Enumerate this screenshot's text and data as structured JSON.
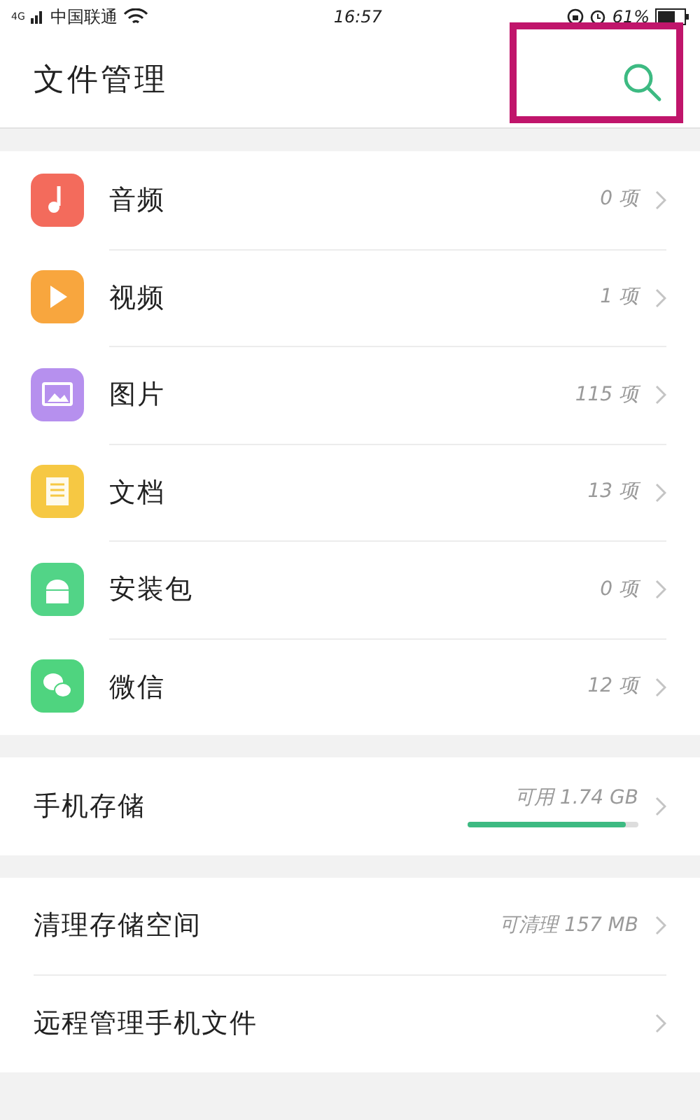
{
  "status_bar": {
    "network": "4G",
    "carrier": "中国联通",
    "time": "16:57",
    "battery": "61%"
  },
  "header": {
    "title": "文件管理",
    "search_highlighted": true
  },
  "categories": [
    {
      "kind": "audio",
      "label": "音频",
      "count": "0 项",
      "color": "#f36b5c"
    },
    {
      "kind": "video",
      "label": "视频",
      "count": "1 项",
      "color": "#f8a63e"
    },
    {
      "kind": "image",
      "label": "图片",
      "count": "115 项",
      "color": "#b690ee"
    },
    {
      "kind": "document",
      "label": "文档",
      "count": "13 项",
      "color": "#f6c843"
    },
    {
      "kind": "apk",
      "label": "安装包",
      "count": "0 项",
      "color": "#52d487"
    },
    {
      "kind": "wechat",
      "label": "微信",
      "count": "12 项",
      "color": "#4fd47f"
    }
  ],
  "storage": {
    "label": "手机存储",
    "free": "可用 1.74 GB",
    "level": 0.93
  },
  "tools": [
    {
      "label": "清理存储空间",
      "value": "可清理 157 MB"
    },
    {
      "label": "远程管理手机文件"
    }
  ]
}
